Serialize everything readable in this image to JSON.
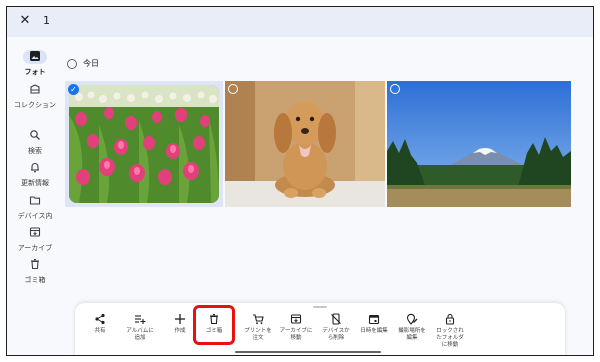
{
  "topbar": {
    "close_icon": "close-icon",
    "selected_count": "1"
  },
  "sidebar": {
    "items": [
      {
        "label": "フォト",
        "icon": "photo-icon",
        "active": true
      },
      {
        "label": "コレクション",
        "icon": "collection-icon"
      },
      {
        "label": "検索",
        "icon": "search-icon"
      },
      {
        "label": "更新情報",
        "icon": "bell-icon"
      },
      {
        "label": "デバイス内",
        "icon": "folder-icon"
      },
      {
        "label": "アーカイブ",
        "icon": "archive-icon"
      },
      {
        "label": "ゴミ箱",
        "icon": "trash-icon"
      }
    ]
  },
  "main": {
    "date_label": "今日",
    "photos": [
      {
        "subject": "tulip field",
        "selected": true
      },
      {
        "subject": "puppy",
        "selected": false
      },
      {
        "subject": "mountain landscape",
        "selected": false
      }
    ]
  },
  "actions": {
    "items": [
      {
        "label": "共有",
        "icon": "share-icon"
      },
      {
        "label": "アルバムに\n追加",
        "icon": "add-to-album-icon"
      },
      {
        "label": "作成",
        "icon": "plus-icon"
      },
      {
        "label": "ゴミ箱",
        "icon": "trash-icon",
        "highlighted": true
      },
      {
        "label": "プリントを\n注文",
        "icon": "cart-icon"
      },
      {
        "label": "アーカイブに\n移動",
        "icon": "archive-icon"
      },
      {
        "label": "デバイスか\nら削除",
        "icon": "delete-from-device-icon"
      },
      {
        "label": "日時を編集",
        "icon": "calendar-icon"
      },
      {
        "label": "撮影場所を\n編集",
        "icon": "location-edit-icon"
      },
      {
        "label": "ロックされ\nたフォルダ\nに移動",
        "icon": "lock-icon"
      }
    ]
  },
  "colors": {
    "accent": "#1a73e8",
    "highlight": "#e8110e",
    "topbar": "#e9edf8"
  }
}
